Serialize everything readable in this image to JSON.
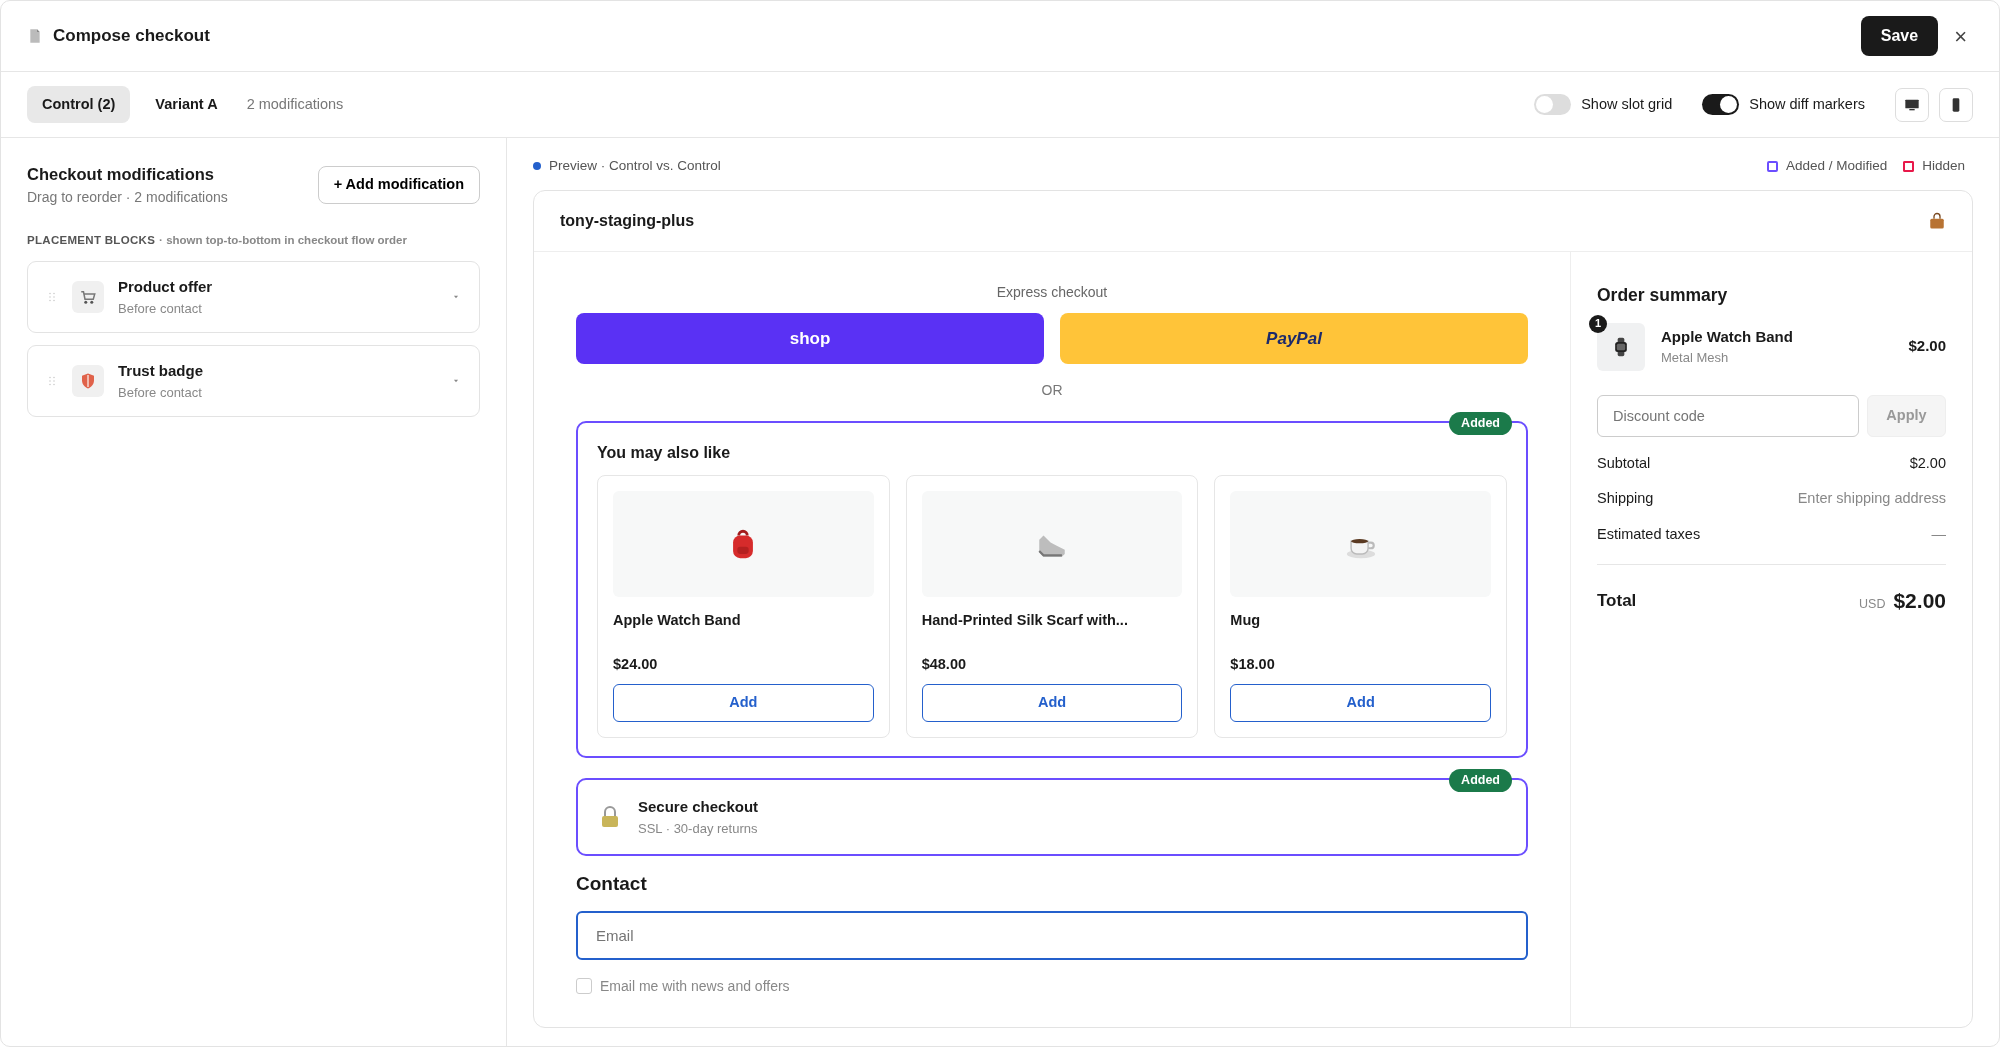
{
  "header": {
    "title": "Compose checkout",
    "save": "Save",
    "close": "×"
  },
  "variant_tabs": [
    {
      "label": "Control (2)",
      "selected": true
    },
    {
      "label": "Variant A",
      "selected": false
    }
  ],
  "modifications_count": "2 modifications",
  "toggles": [
    {
      "label": "Show slot grid",
      "on": false
    },
    {
      "label": "Show diff markers",
      "on": true
    }
  ],
  "device_buttons": [
    {
      "kind": "desktop"
    },
    {
      "kind": "mobile"
    }
  ],
  "sidebar": {
    "title": "Checkout modifications",
    "subtitle": "Drag to reorder · 2 modifications",
    "add_button": "+ Add modification",
    "section_label": "PLACEMENT BLOCKS",
    "section_note": "· shown top-to-bottom in checkout flow order",
    "blocks": [
      {
        "kind": "cart",
        "title": "Product offer",
        "subtitle": "Before contact"
      },
      {
        "kind": "shield",
        "title": "Trust badge",
        "subtitle": "Before contact"
      }
    ]
  },
  "preview": {
    "label": "Preview · Control vs. Control",
    "legend": [
      {
        "kind": "added",
        "label": "Added / Modified",
        "color": "#6b4eff"
      },
      {
        "kind": "hidden",
        "label": "Hidden",
        "color": "#e8194a"
      }
    ],
    "store": "tony-staging-plus",
    "express_label": "Express checkout",
    "express_buttons": [
      {
        "kind": "shop",
        "label": "shop"
      },
      {
        "kind": "paypal",
        "label": "PayPal"
      }
    ],
    "or": "OR",
    "blocks": [
      {
        "kind": "upsell",
        "badge": "Added",
        "title": "You may also like",
        "products": [
          {
            "kind": "backpack",
            "name": "Apple Watch Band",
            "price": "$24.00",
            "button": "Add"
          },
          {
            "kind": "shoe",
            "name": "Hand-Printed Silk Scarf with...",
            "price": "$48.00",
            "button": "Add"
          },
          {
            "kind": "cup",
            "name": "Mug",
            "price": "$18.00",
            "button": "Add"
          }
        ]
      },
      {
        "kind": "trust",
        "badge": "Added",
        "title": "Secure checkout",
        "subtitle": "SSL · 30-day returns"
      }
    ],
    "contact": {
      "title": "Contact",
      "placeholder": "Email",
      "focused": true,
      "checkbox": {
        "label": "Email me with news and offers",
        "checked": false
      }
    }
  },
  "summary": {
    "title": "Order summary",
    "item": {
      "quantity": "1",
      "name": "Apple Watch Band",
      "variant": "Metal Mesh",
      "price": "$2.00"
    },
    "discount": {
      "placeholder": "Discount code",
      "button": "Apply"
    },
    "lines": [
      {
        "label": "Subtotal",
        "value": "$2.00",
        "muted": false
      },
      {
        "label": "Shipping",
        "value": "Enter shipping address",
        "muted": true
      },
      {
        "label": "Estimated taxes",
        "value": "—",
        "muted": true
      }
    ],
    "total": {
      "label": "Total",
      "currency": "USD",
      "value": "$2.00"
    }
  }
}
